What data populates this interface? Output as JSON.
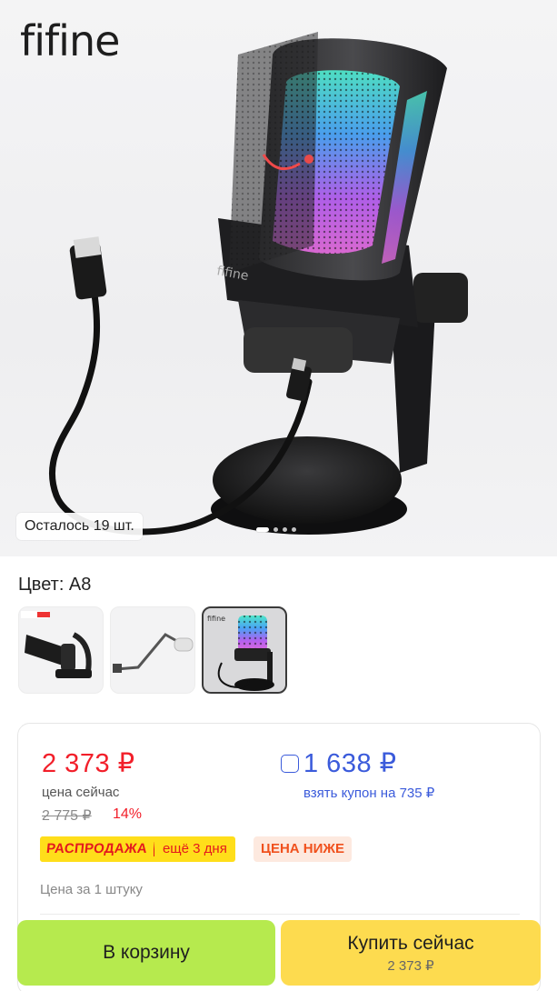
{
  "hero": {
    "brand": "fifine",
    "stock_text": "Осталось 19 шт.",
    "gallery_dots": [
      true,
      false,
      false,
      false
    ]
  },
  "variant": {
    "color_label": "Цвет: A8",
    "thumbnails": [
      {
        "name": "mic-on-desk-arm",
        "selected": false
      },
      {
        "name": "mic-boom-arm",
        "selected": false
      },
      {
        "name": "mic-rgb-a8",
        "selected": true
      }
    ]
  },
  "price": {
    "current": "2 373 ₽",
    "current_caption": "цена сейчас",
    "old": "2 775 ₽",
    "discount": "14%",
    "coupon_price": "1 638 ₽",
    "coupon_caption": "взять купон на 735 ₽",
    "sale_label": "РАСПРОДАЖА",
    "sale_days": "ещё 3 дня",
    "lower_price_label": "ЦЕНА НИЖЕ",
    "per_unit": "Цена за 1 штуку"
  },
  "actions": {
    "add_to_cart": "В корзину",
    "buy_now": "Купить сейчас",
    "buy_now_price": "2 373 ₽"
  },
  "colors": {
    "price_red": "#f21f2a",
    "coupon_blue": "#3b5bdb",
    "cart_green": "#b6ea4e",
    "buy_yellow": "#fddb4f"
  }
}
